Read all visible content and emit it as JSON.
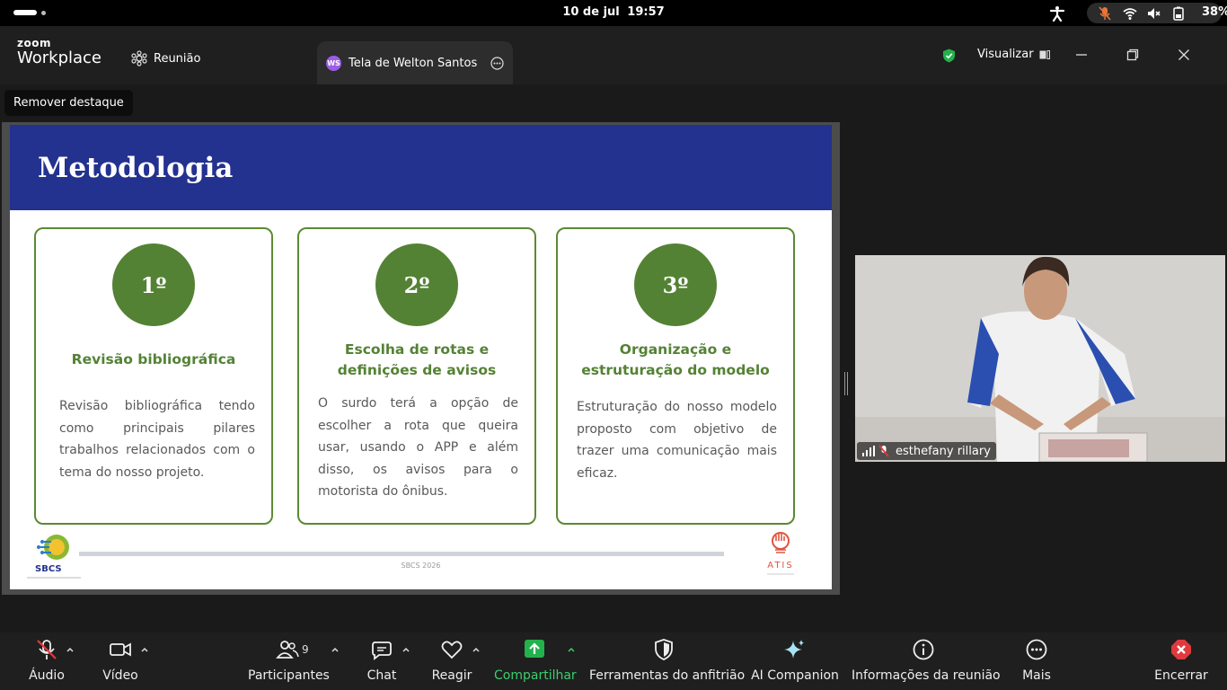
{
  "system": {
    "date": "10 de jul",
    "time": "19:57",
    "battery": "38%"
  },
  "app": {
    "logo_top": "zoom",
    "logo_bottom": "Workplace",
    "tabs": [
      {
        "label": "Reunião"
      },
      {
        "label": "Tela de Welton Santos",
        "badge": "WS"
      }
    ],
    "view_label": "Visualizar"
  },
  "stage": {
    "remove_spotlight": "Remover destaque"
  },
  "slide": {
    "title": "Metodologia",
    "cards": [
      {
        "number": "1º",
        "title": "Revisão bibliográfica",
        "body": "Revisão bibliográfica tendo como principais pilares trabalhos relacionados com o tema do nosso projeto."
      },
      {
        "number": "2º",
        "title": "Escolha de rotas e definições de avisos",
        "body": "O surdo terá a opção de escolher a rota que queira usar, usando o APP e além disso, os avisos para o motorista do ônibus."
      },
      {
        "number": "3º",
        "title": "Organização e estruturação do modelo",
        "body": "Estruturação do nosso modelo proposto com objetivo de trazer uma comunicação mais eficaz."
      }
    ],
    "footer": "SBCS 2026",
    "logo_left": "SBCS",
    "logo_right": "ATIS"
  },
  "video": {
    "participant_name": "esthefany rillary"
  },
  "toolbar": {
    "audio": "Áudio",
    "video": "Vídeo",
    "participants": "Participantes",
    "participants_count": "9",
    "chat": "Chat",
    "react": "Reagir",
    "share": "Compartilhar",
    "host_tools": "Ferramentas do anfitrião",
    "ai_companion": "AI Companion",
    "meeting_info": "Informações da reunião",
    "more": "Mais",
    "end": "Encerrar"
  },
  "colors": {
    "slide_header": "#23318f",
    "card_green": "#548235",
    "share_green": "#3bcf6e",
    "end_red": "#e0393e",
    "ws_badge": "#9b5de5"
  }
}
